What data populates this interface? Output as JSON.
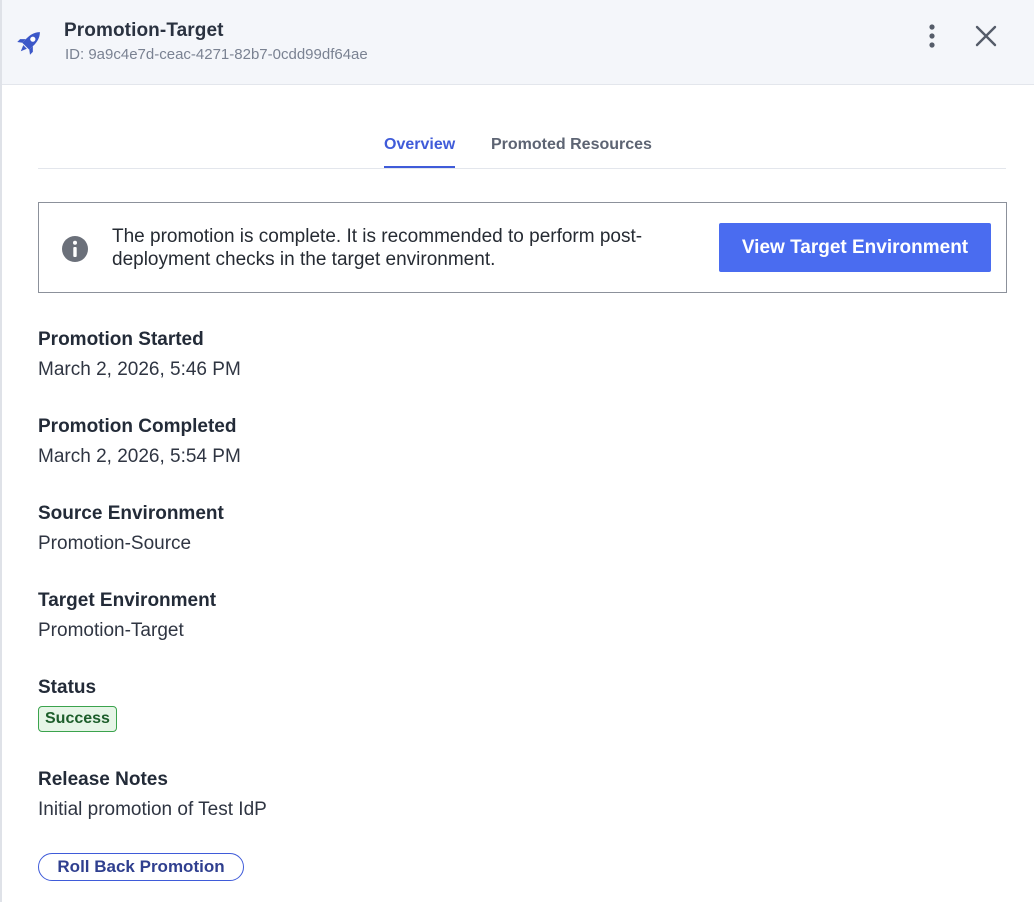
{
  "header": {
    "title": "Promotion-Target",
    "id_line": "ID: 9a9c4e7d-ceac-4271-82b7-0cdd99df64ae",
    "icon": "rocket-icon",
    "more_icon": "kebab-menu-icon",
    "close_icon": "close-icon"
  },
  "tabs": [
    {
      "label": "Overview",
      "active": true
    },
    {
      "label": "Promoted Resources",
      "active": false
    }
  ],
  "notice": {
    "icon": "info-icon",
    "message": "The promotion is complete. It is recommended to perform post-deployment checks in the target environment.",
    "button_label": "View Target Environment"
  },
  "details": {
    "promotion_started": {
      "label": "Promotion Started",
      "value": "March 2, 2026, 5:46 PM"
    },
    "promotion_completed": {
      "label": "Promotion Completed",
      "value": "March 2, 2026, 5:54 PM"
    },
    "source_environment": {
      "label": "Source Environment",
      "value": "Promotion-Source"
    },
    "target_environment": {
      "label": "Target Environment",
      "value": "Promotion-Target"
    },
    "status": {
      "label": "Status",
      "value": "Success"
    },
    "release_notes": {
      "label": "Release Notes",
      "value": "Initial promotion of Test IdP"
    }
  },
  "actions": {
    "rollback_label": "Roll Back Promotion"
  },
  "colors": {
    "accent": "#3f5bd9",
    "primary_button": "#4a6cf0",
    "success_border": "#3ba34d",
    "success_bg": "#e6f5e7",
    "header_bg": "#f4f6fa"
  }
}
